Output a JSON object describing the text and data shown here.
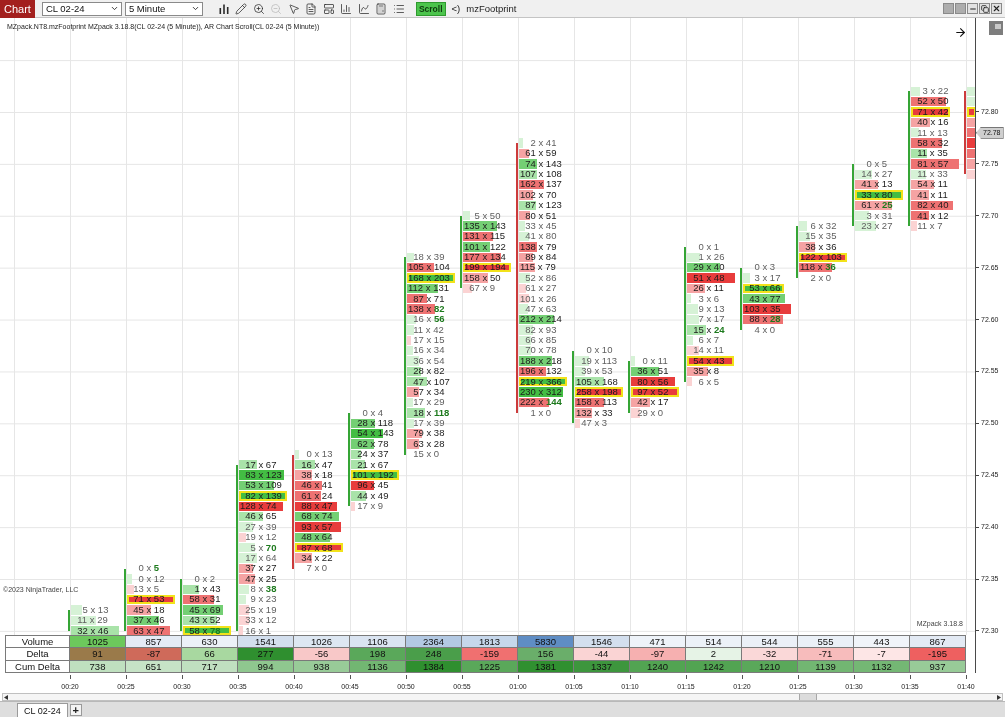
{
  "toolbar": {
    "tab": "Chart",
    "instrument": "CL 02-24",
    "interval": "5 Minute",
    "tools": [
      {
        "disabled": false
      },
      {
        "disabled": false
      },
      {
        "disabled": false
      },
      {
        "disabled": true
      },
      {
        "disabled": false
      },
      {
        "disabled": false
      },
      {
        "disabled": false
      },
      {
        "disabled": false
      },
      {
        "disabled": false
      },
      {
        "disabled": false
      },
      {
        "disabled": false
      }
    ],
    "scroll": {
      "label": "Scroll",
      "on": true
    },
    "scroll_mark": "<)",
    "indicator": "mzFootprint"
  },
  "chart": {
    "legend": "MZpack.NT8.mzFootprint MZpack 3.18.8(CL 02-24 (5 Minute)), AR Chart Scroll(CL 02-24 (5 Minute))",
    "copyright": "©2023 NinjaTrader, LLC",
    "version": "MZpack 3.18.8",
    "columns": [
      {
        "rising": true,
        "rows": [
          {},
          {},
          {},
          {},
          {},
          {},
          {},
          {},
          {},
          {},
          {},
          {},
          {},
          {},
          {},
          {},
          {},
          {},
          {},
          {},
          {},
          {},
          {},
          {},
          {},
          {},
          {},
          {},
          {},
          {},
          {},
          {},
          {},
          {},
          {},
          {},
          {},
          {},
          {},
          {},
          {},
          {},
          {},
          {},
          {},
          {},
          {},
          {},
          {},
          {},
          {
            "text": "5 x 13",
            "color": "#d6f2d6",
            "poc": false
          },
          {
            "text": "11 x 29",
            "color": "#d6f2d6",
            "poc": false
          },
          {
            "text": "32 x 46",
            "color": "#a9e3a9",
            "poc": false
          }
        ]
      },
      {
        "rising": true,
        "rows": [
          {},
          {},
          {},
          {},
          {},
          {},
          {},
          {},
          {},
          {},
          {},
          {},
          {},
          {},
          {},
          {},
          {},
          {},
          {},
          {},
          {},
          {},
          {},
          {},
          {},
          {},
          {},
          {},
          {},
          {},
          {},
          {},
          {},
          {},
          {},
          {},
          {},
          {},
          {},
          {},
          {},
          {},
          {},
          {},
          {},
          {},
          {
            "text": "0 x **5**",
            "poc": false
          },
          {
            "text": "0 x 12",
            "color": "#d6f2d6",
            "poc": false
          },
          {
            "text": "13 x 5",
            "color": "#fbd3d3",
            "poc": false
          },
          {
            "text": "71 x 53",
            "color": "#e83c3c",
            "poc": true
          },
          {
            "text": "45 x 18",
            "color": "#f5a3a3",
            "poc": false
          },
          {
            "text": "37 x 46",
            "color": "#74cf74",
            "poc": false
          },
          {
            "text": "63 x 47",
            "color": "#ee7272",
            "poc": false
          }
        ]
      },
      {
        "rising": true,
        "rows": [
          {},
          {},
          {},
          {},
          {},
          {},
          {},
          {},
          {},
          {},
          {},
          {},
          {},
          {},
          {},
          {},
          {},
          {},
          {},
          {},
          {},
          {},
          {},
          {},
          {},
          {},
          {},
          {},
          {},
          {},
          {},
          {},
          {},
          {},
          {},
          {},
          {},
          {},
          {},
          {},
          {},
          {},
          {},
          {},
          {},
          {},
          {},
          {
            "text": "0 x 2",
            "poc": false
          },
          {
            "text": "1 x 43",
            "color": "#a9e3a9",
            "poc": false
          },
          {
            "text": "58 x 31",
            "color": "#ee7272",
            "poc": false
          },
          {
            "text": "45 x 69",
            "color": "#74cf74",
            "poc": false
          },
          {
            "text": "43 x 52",
            "color": "#a9e3a9",
            "poc": false
          },
          {
            "text": "58 x **78**",
            "color": "#43bd43",
            "poc": true
          }
        ]
      },
      {
        "rising": true,
        "rows": [
          {},
          {},
          {},
          {},
          {},
          {},
          {},
          {},
          {},
          {},
          {},
          {},
          {},
          {},
          {},
          {},
          {},
          {},
          {},
          {},
          {},
          {},
          {},
          {},
          {},
          {},
          {},
          {},
          {},
          {},
          {},
          {},
          {},
          {},
          {},
          {},
          {
            "text": "17 x 67",
            "color": "#a9e3a9",
            "poc": false
          },
          {
            "text": "83 x 123",
            "color": "#43bd43",
            "poc": false
          },
          {
            "text": "53 x 109",
            "color": "#74cf74",
            "poc": false
          },
          {
            "text": "82 x 139",
            "color": "#43bd43",
            "poc": true
          },
          {
            "text": "128 x 74",
            "color": "#e83c3c",
            "poc": false
          },
          {
            "text": "46 x 65",
            "color": "#a9e3a9",
            "poc": false
          },
          {
            "text": "27 x 39",
            "color": "#d6f2d6",
            "poc": false
          },
          {
            "text": "19 x 12",
            "color": "#fbd3d3",
            "poc": false
          },
          {
            "text": "5 x **70**",
            "color": "#d6f2d6",
            "poc": false
          },
          {
            "text": "17 x 64",
            "color": "#d6f2d6",
            "poc": false
          },
          {
            "text": "37 x 27",
            "color": "#f5a3a3",
            "poc": false
          },
          {
            "text": "47 x 25",
            "color": "#f5a3a3",
            "poc": false
          },
          {
            "text": "8 x **38**",
            "color": "#d6f2d6",
            "poc": false
          },
          {
            "text": "9 x 23",
            "color": "#d6f2d6",
            "poc": false
          },
          {
            "text": "25 x 19",
            "color": "#fbd3d3",
            "poc": false
          },
          {
            "text": "33 x 12",
            "color": "#fbd3d3",
            "poc": false
          },
          {
            "text": "16 x 1",
            "color": "#fbd3d3",
            "poc": false
          }
        ]
      },
      {
        "rising": false,
        "rows": [
          {},
          {},
          {},
          {},
          {},
          {},
          {},
          {},
          {},
          {},
          {},
          {},
          {},
          {},
          {},
          {},
          {},
          {},
          {},
          {},
          {},
          {},
          {},
          {},
          {},
          {},
          {},
          {},
          {},
          {},
          {},
          {},
          {},
          {},
          {},
          {
            "text": "0 x 13",
            "color": "#d6f2d6",
            "poc": false
          },
          {
            "text": "16 x 47",
            "color": "#a9e3a9",
            "poc": false
          },
          {
            "text": "38 x 18",
            "color": "#f5a3a3",
            "poc": false
          },
          {
            "text": "46 x 41",
            "color": "#ee7272",
            "poc": false
          },
          {
            "text": "61 x 24",
            "color": "#ee7272",
            "poc": false
          },
          {
            "text": "88 x 47",
            "color": "#e83c3c",
            "poc": false
          },
          {
            "text": "68 x 74",
            "color": "#74cf74",
            "poc": false
          },
          {
            "text": "93 x 57",
            "color": "#e83c3c",
            "poc": false
          },
          {
            "text": "48 x 64",
            "color": "#74cf74",
            "poc": false
          },
          {
            "text": "87 x 68",
            "color": "#e83c3c",
            "poc": true
          },
          {
            "text": "34 x 22",
            "color": "#f5a3a3",
            "poc": false
          },
          {
            "text": "7 x 0",
            "poc": false
          }
        ]
      },
      {
        "rising": true,
        "rows": [
          {},
          {},
          {},
          {},
          {},
          {},
          {},
          {},
          {},
          {},
          {},
          {},
          {},
          {},
          {},
          {},
          {},
          {},
          {},
          {},
          {},
          {},
          {},
          {},
          {},
          {},
          {},
          {},
          {},
          {},
          {},
          {
            "text": "0 x 4",
            "poc": false
          },
          {
            "text": "28 x 118",
            "color": "#74cf74",
            "poc": false
          },
          {
            "text": "54 x 143",
            "color": "#43bd43",
            "poc": false
          },
          {
            "text": "62 x 78",
            "color": "#74cf74",
            "poc": false
          },
          {
            "text": "24 x 37",
            "color": "#a9e3a9",
            "poc": false
          },
          {
            "text": "21 x 67",
            "color": "#a9e3a9",
            "poc": false
          },
          {
            "text": "101 x 192",
            "color": "#43bd43",
            "poc": true
          },
          {
            "text": "96 x 45",
            "color": "#e83c3c",
            "poc": false
          },
          {
            "text": "44 x 49",
            "color": "#a9e3a9",
            "poc": false
          },
          {
            "text": "17 x 9",
            "color": "#fbd3d3",
            "poc": false
          }
        ]
      },
      {
        "rising": true,
        "rows": [
          {},
          {},
          {},
          {},
          {},
          {},
          {},
          {},
          {},
          {},
          {},
          {},
          {},
          {},
          {},
          {},
          {
            "text": "18 x 39",
            "color": "#d6f2d6",
            "poc": false
          },
          {
            "text": "105 x 104",
            "color": "#ee7272",
            "poc": false
          },
          {
            "text": "168 x 203",
            "color": "#43bd43",
            "poc": true
          },
          {
            "text": "112 x 131",
            "color": "#74cf74",
            "poc": false
          },
          {
            "text": "87 x 71",
            "color": "#ee7272",
            "poc": false
          },
          {
            "text": "138 x **82**",
            "color": "#ee7272",
            "poc": false
          },
          {
            "text": "16 x **56**",
            "color": "#d6f2d6",
            "poc": false
          },
          {
            "text": "11 x 42",
            "color": "#d6f2d6",
            "poc": false
          },
          {
            "text": "17 x 15",
            "color": "#fbd3d3",
            "poc": false
          },
          {
            "text": "16 x 34",
            "color": "#d6f2d6",
            "poc": false
          },
          {
            "text": "36 x 54",
            "color": "#d6f2d6",
            "poc": false
          },
          {
            "text": "28 x 82",
            "color": "#a9e3a9",
            "poc": false
          },
          {
            "text": "47 x 107",
            "color": "#a9e3a9",
            "poc": false
          },
          {
            "text": "57 x 34",
            "color": "#f5a3a3",
            "poc": false
          },
          {
            "text": "17 x 29",
            "color": "#d6f2d6",
            "poc": false
          },
          {
            "text": "18 x **118**",
            "color": "#a9e3a9",
            "poc": false
          },
          {
            "text": "17 x 39",
            "color": "#d6f2d6",
            "poc": false
          },
          {
            "text": "79 x 38",
            "color": "#f5a3a3",
            "poc": false
          },
          {
            "text": "63 x 28",
            "color": "#f5a3a3",
            "poc": false
          },
          {
            "text": "15 x 0",
            "poc": false
          }
        ]
      },
      {
        "rising": true,
        "rows": [
          {},
          {},
          {},
          {},
          {},
          {},
          {},
          {},
          {},
          {},
          {},
          {},
          {
            "text": "5 x 50",
            "color": "#d6f2d6",
            "poc": false
          },
          {
            "text": "135 x 143",
            "color": "#74cf74",
            "poc": false
          },
          {
            "text": "131 x 115",
            "color": "#ee7272",
            "poc": false
          },
          {
            "text": "101 x 122",
            "color": "#74cf74",
            "poc": false
          },
          {
            "text": "177 x 134",
            "color": "#ee7272",
            "poc": false
          },
          {
            "text": "199 x 194",
            "color": "#e83c3c",
            "poc": true
          },
          {
            "text": "158 x 50",
            "color": "#f5a3a3",
            "poc": false
          },
          {
            "text": "67 x 9",
            "color": "#fbd3d3",
            "poc": false
          }
        ]
      },
      {
        "rising": false,
        "rows": [
          {},
          {},
          {},
          {},
          {},
          {
            "text": "2 x 41",
            "color": "#d6f2d6",
            "poc": false
          },
          {
            "text": "61 x 59",
            "color": "#f5a3a3",
            "poc": false
          },
          {
            "text": "74 x 143",
            "color": "#74cf74",
            "poc": false
          },
          {
            "text": "107 x 108",
            "color": "#a9e3a9",
            "poc": false
          },
          {
            "text": "162 x 137",
            "color": "#ee7272",
            "poc": false
          },
          {
            "text": "102 x 70",
            "color": "#f5a3a3",
            "poc": false
          },
          {
            "text": "87 x 123",
            "color": "#a9e3a9",
            "poc": false
          },
          {
            "text": "80 x 51",
            "color": "#f5a3a3",
            "poc": false
          },
          {
            "text": "33 x 45",
            "color": "#d6f2d6",
            "poc": false
          },
          {
            "text": "41 x 80",
            "color": "#d6f2d6",
            "poc": false
          },
          {
            "text": "138 x 79",
            "color": "#ee7272",
            "poc": false
          },
          {
            "text": "89 x 84",
            "color": "#f5a3a3",
            "poc": false
          },
          {
            "text": "115 x 79",
            "color": "#f5a3a3",
            "poc": false
          },
          {
            "text": "52 x 86",
            "color": "#d6f2d6",
            "poc": false
          },
          {
            "text": "61 x 27",
            "color": "#fbd3d3",
            "poc": false
          },
          {
            "text": "101 x 26",
            "color": "#fbd3d3",
            "poc": false
          },
          {
            "text": "47 x 63",
            "color": "#d6f2d6",
            "poc": false
          },
          {
            "text": "212 x 214",
            "color": "#74cf74",
            "poc": false
          },
          {
            "text": "82 x 93",
            "color": "#d6f2d6",
            "poc": false
          },
          {
            "text": "66 x 85",
            "color": "#d6f2d6",
            "poc": false
          },
          {
            "text": "70 x 78",
            "color": "#d6f2d6",
            "poc": false
          },
          {
            "text": "188 x 218",
            "color": "#74cf74",
            "poc": false
          },
          {
            "text": "196 x 132",
            "color": "#ee7272",
            "poc": false
          },
          {
            "text": "219 x 366",
            "color": "#43bd43",
            "poc": true
          },
          {
            "text": "230 x 312",
            "color": "#43bd43",
            "poc": false
          },
          {
            "text": "222 x **144**",
            "color": "#ee7272",
            "poc": false
          },
          {
            "text": "1 x 0",
            "poc": false
          }
        ]
      },
      {
        "rising": true,
        "rows": [
          {},
          {},
          {},
          {},
          {},
          {},
          {},
          {},
          {},
          {},
          {},
          {},
          {},
          {},
          {},
          {},
          {},
          {},
          {},
          {},
          {},
          {},
          {},
          {},
          {},
          {
            "text": "0 x 10",
            "poc": false
          },
          {
            "text": "19 x 113",
            "color": "#d6f2d6",
            "poc": false
          },
          {
            "text": "39 x 53",
            "color": "#d6f2d6",
            "poc": false
          },
          {
            "text": "105 x 168",
            "color": "#a9e3a9",
            "poc": false
          },
          {
            "text": "258 x 198",
            "color": "#e83c3c",
            "poc": true
          },
          {
            "text": "158 x 113",
            "color": "#ee7272",
            "poc": false
          },
          {
            "text": "132 x 33",
            "color": "#f5a3a3",
            "poc": false
          },
          {
            "text": "47 x 3",
            "color": "#fbd3d3",
            "poc": false
          }
        ]
      },
      {
        "rising": true,
        "rows": [
          {},
          {},
          {},
          {},
          {},
          {},
          {},
          {},
          {},
          {},
          {},
          {},
          {},
          {},
          {},
          {},
          {},
          {},
          {},
          {},
          {},
          {},
          {},
          {},
          {},
          {},
          {
            "text": "0 x 11",
            "color": "#d6f2d6",
            "poc": false
          },
          {
            "text": "36 x 51",
            "color": "#74cf74",
            "poc": false
          },
          {
            "text": "80 x 56",
            "color": "#e83c3c",
            "poc": false
          },
          {
            "text": "97 x 52",
            "color": "#e83c3c",
            "poc": true
          },
          {
            "text": "42 x 17",
            "color": "#f5a3a3",
            "poc": false
          },
          {
            "text": "29 x 0",
            "color": "#fbd3d3",
            "poc": false
          }
        ]
      },
      {
        "rising": true,
        "rows": [
          {},
          {},
          {},
          {},
          {},
          {},
          {},
          {},
          {},
          {},
          {},
          {},
          {},
          {},
          {},
          {
            "text": "0 x 1",
            "poc": false
          },
          {
            "text": "1 x 26",
            "color": "#d6f2d6",
            "poc": false
          },
          {
            "text": "29 x 40",
            "color": "#74cf74",
            "poc": false
          },
          {
            "text": "51 x 48",
            "color": "#e83c3c",
            "poc": false
          },
          {
            "text": "26 x 11",
            "color": "#f5a3a3",
            "poc": false
          },
          {
            "text": "3 x 6",
            "color": "#d6f2d6",
            "poc": false
          },
          {
            "text": "9 x 13",
            "color": "#d6f2d6",
            "poc": false
          },
          {
            "text": "7 x 17",
            "color": "#d6f2d6",
            "poc": false
          },
          {
            "text": "15 x **24**",
            "color": "#a9e3a9",
            "poc": false
          },
          {
            "text": "6 x 7",
            "color": "#d6f2d6",
            "poc": false
          },
          {
            "text": "14 x 11",
            "color": "#fbd3d3",
            "poc": false
          },
          {
            "text": "54 x 43",
            "color": "#e83c3c",
            "poc": true
          },
          {
            "text": "35 x 8",
            "color": "#f5a3a3",
            "poc": false
          },
          {
            "text": "6 x 5",
            "color": "#fbd3d3",
            "poc": false
          }
        ]
      },
      {
        "rising": true,
        "rows": [
          {},
          {},
          {},
          {},
          {},
          {},
          {},
          {},
          {},
          {},
          {},
          {},
          {},
          {},
          {},
          {},
          {},
          {
            "text": "0 x 3",
            "poc": false
          },
          {
            "text": "3 x 17",
            "color": "#d6f2d6",
            "poc": false
          },
          {
            "text": "53 x 66",
            "color": "#43bd43",
            "poc": true
          },
          {
            "text": "43 x 77",
            "color": "#74cf74",
            "poc": false
          },
          {
            "text": "103 x 35",
            "color": "#e83c3c",
            "poc": false
          },
          {
            "text": "88 x **28**",
            "color": "#ee7272",
            "poc": false
          },
          {
            "text": "4 x 0",
            "poc": false
          }
        ]
      },
      {
        "rising": true,
        "rows": [
          {},
          {},
          {},
          {},
          {},
          {},
          {},
          {},
          {},
          {},
          {},
          {},
          {},
          {
            "text": "6 x 32",
            "color": "#d6f2d6",
            "poc": false
          },
          {
            "text": "15 x 35",
            "color": "#d6f2d6",
            "poc": false
          },
          {
            "text": "38 x 36",
            "color": "#f5a3a3",
            "poc": false
          },
          {
            "text": "122 x 103",
            "color": "#e83c3c",
            "poc": true
          },
          {
            "text": "118 x **36**",
            "color": "#ee7272",
            "poc": false
          },
          {
            "text": "2 x 0",
            "poc": false
          }
        ]
      },
      {
        "rising": true,
        "rows": [
          {},
          {},
          {},
          {},
          {},
          {},
          {},
          {
            "text": "0 x 5",
            "poc": false
          },
          {
            "text": "14 x 27",
            "color": "#d6f2d6",
            "poc": false
          },
          {
            "text": "41 x 13",
            "color": "#f5a3a3",
            "poc": false
          },
          {
            "text": "33 x 80",
            "color": "#43bd43",
            "poc": true
          },
          {
            "text": "61 x **25**",
            "color": "#f5a3a3",
            "poc": false
          },
          {
            "text": "3 x 31",
            "color": "#d6f2d6",
            "poc": false
          },
          {
            "text": "23 x 27",
            "color": "#d6f2d6",
            "poc": false
          }
        ]
      },
      {
        "rising": true,
        "rows": [
          {
            "text": "3 x 22",
            "color": "#d6f2d6",
            "poc": false
          },
          {
            "text": "52 x 50",
            "color": "#ee7272",
            "poc": false
          },
          {
            "text": "71 x 42",
            "color": "#e83c3c",
            "poc": true
          },
          {
            "text": "40 x 16",
            "color": "#f5a3a3",
            "poc": false
          },
          {
            "text": "11 x 13",
            "color": "#d6f2d6",
            "poc": false
          },
          {
            "text": "58 x 32",
            "color": "#ee7272",
            "poc": false
          },
          {
            "text": "11 x 35",
            "color": "#a9e3a9",
            "poc": false
          },
          {
            "text": "81 x 57",
            "color": "#ee7272",
            "poc": false
          },
          {
            "text": "11 x 33",
            "color": "#d6f2d6",
            "poc": false
          },
          {
            "text": "54 x 11",
            "color": "#f5a3a3",
            "poc": false
          },
          {
            "text": "41 x 11",
            "color": "#f5a3a3",
            "poc": false
          },
          {
            "text": "82 x 40",
            "color": "#ee7272",
            "poc": false
          },
          {
            "text": "41 x 12",
            "color": "#ee7272",
            "poc": false
          },
          {
            "text": "11 x 7",
            "color": "#fbd3d3",
            "poc": false
          }
        ]
      },
      {
        "rising": false,
        "rows": [
          {
            "color": "#d6f2d6",
            "poc": false
          },
          {
            "color": "#d6f2d6",
            "poc": false
          },
          {
            "color": "#e83c3c",
            "poc": true
          },
          {
            "color": "#f5a3a3",
            "poc": false
          },
          {
            "color": "#ee7272",
            "poc": false
          },
          {
            "color": "#e83c3c",
            "poc": false
          },
          {
            "color": "#ee7272",
            "poc": false
          },
          {
            "color": "#f5a3a3",
            "poc": false
          },
          {
            "color": "#fbd3d3",
            "poc": false
          }
        ]
      }
    ],
    "summary": [
      {
        "label": "Volume",
        "cells": [
          {
            "text": "1025",
            "color": "#6cc85c"
          },
          {
            "text": "857",
            "color": "#e4ebf5"
          },
          {
            "text": "630",
            "color": "#ecf1f8"
          },
          {
            "text": "1541",
            "color": "#d3dfee"
          },
          {
            "text": "1026",
            "color": "#dde7f2"
          },
          {
            "text": "1106",
            "color": "#dae4f1"
          },
          {
            "text": "2364",
            "color": "#b3c9e3"
          },
          {
            "text": "1813",
            "color": "#c6d7eb"
          },
          {
            "text": "5830",
            "color": "#5f8dc4"
          },
          {
            "text": "1546",
            "color": "#d3dfee"
          },
          {
            "text": "471",
            "color": "#eef3f9"
          },
          {
            "text": "514",
            "color": "#ecf1f8"
          },
          {
            "text": "544",
            "color": "#ebf0f7"
          },
          {
            "text": "555",
            "color": "#eaf0f7"
          },
          {
            "text": "443",
            "color": "#f0f4f9"
          },
          {
            "text": "867",
            "color": "#e3eaf4"
          }
        ]
      },
      {
        "label": "Delta",
        "cells": [
          {
            "text": "91",
            "color": "#9a7a4a"
          },
          {
            "text": "-87",
            "color": "#cf6a5a"
          },
          {
            "text": "66",
            "color": "#a8d8a0"
          },
          {
            "text": "277",
            "color": "#2f8f2f"
          },
          {
            "text": "-56",
            "color": "#f8c8c8"
          },
          {
            "text": "198",
            "color": "#5aa85a"
          },
          {
            "text": "248",
            "color": "#4a9e4a"
          },
          {
            "text": "-159",
            "color": "#f07070"
          },
          {
            "text": "156",
            "color": "#6aae6a"
          },
          {
            "text": "-44",
            "color": "#fad4d4"
          },
          {
            "text": "-97",
            "color": "#f6b0b0"
          },
          {
            "text": "2",
            "color": "#e6f3e6"
          },
          {
            "text": "-32",
            "color": "#fad8d8"
          },
          {
            "text": "-71",
            "color": "#f7bcbc"
          },
          {
            "text": "-7",
            "color": "#fde6e6"
          },
          {
            "text": "-195",
            "color": "#ee6060"
          }
        ]
      },
      {
        "label": "Cum Delta",
        "cells": [
          {
            "text": "738",
            "color": "#bfe0bf"
          },
          {
            "text": "651",
            "color": "#c6e3c6"
          },
          {
            "text": "717",
            "color": "#c0e0c0"
          },
          {
            "text": "994",
            "color": "#8fc78f"
          },
          {
            "text": "938",
            "color": "#98cb98"
          },
          {
            "text": "1136",
            "color": "#72b672"
          },
          {
            "text": "1384",
            "color": "#2f8f2f"
          },
          {
            "text": "1225",
            "color": "#5aa85a"
          },
          {
            "text": "1381",
            "color": "#309030"
          },
          {
            "text": "1337",
            "color": "#3d963d"
          },
          {
            "text": "1240",
            "color": "#52a452"
          },
          {
            "text": "1242",
            "color": "#52a452"
          },
          {
            "text": "1210",
            "color": "#5aa85a"
          },
          {
            "text": "1139",
            "color": "#72b672"
          },
          {
            "text": "1132",
            "color": "#74b774"
          },
          {
            "text": "937",
            "color": "#98cb98"
          }
        ]
      }
    ],
    "time_labels": [
      "00:20",
      "00:25",
      "00:30",
      "00:35",
      "00:40",
      "00:45",
      "00:50",
      "00:55",
      "01:00",
      "01:05",
      "01:10",
      "01:15",
      "01:20",
      "01:25",
      "01:30",
      "01:35",
      "01:40"
    ],
    "price_labels": [
      "72.80",
      "72.75",
      "72.70",
      "72.65",
      "72.60",
      "72.55",
      "72.50",
      "72.45",
      "72.40",
      "72.35",
      "72.30"
    ],
    "last_price": "72.78"
  },
  "tabs": [
    {
      "label": "CL 02-24",
      "selected": true
    }
  ],
  "add_tab": "+"
}
